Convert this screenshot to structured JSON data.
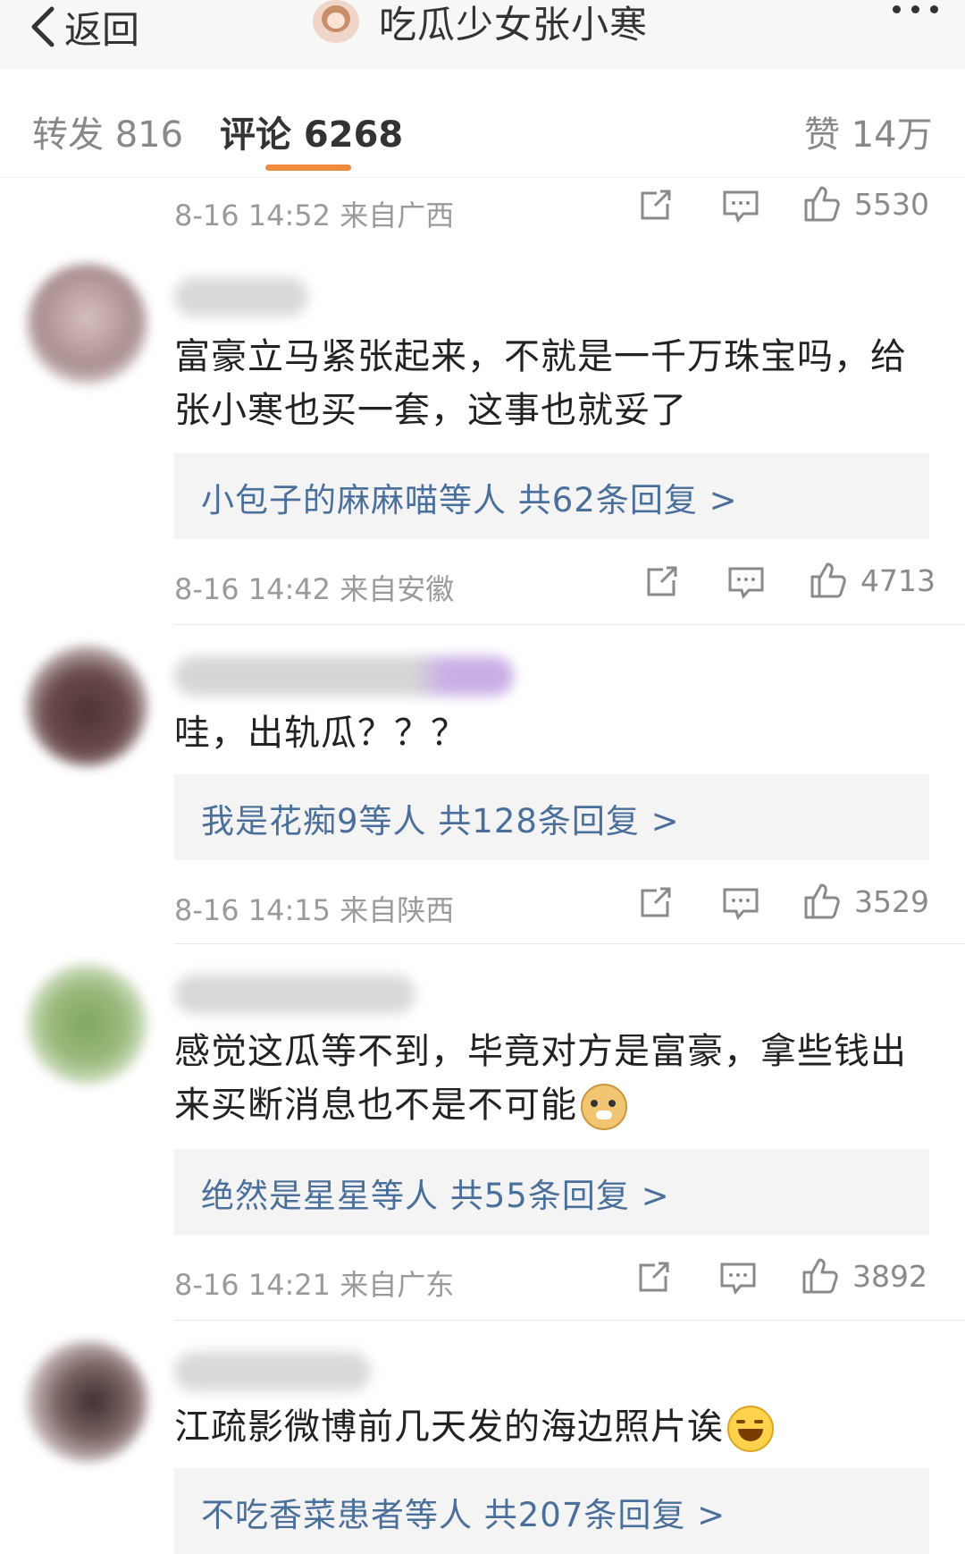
{
  "nav": {
    "back_label": "返回",
    "title": "吃瓜少女张小寒"
  },
  "tabs": [
    {
      "label": "转发 816"
    },
    {
      "label": "评论 6268"
    },
    {
      "label": "赞 14万"
    }
  ],
  "top_meta": {
    "time_location": "8-16 14:52  来自广西",
    "likes": "5530"
  },
  "comments": [
    {
      "text": "富豪立马紧张起来，不就是一千万珠宝吗，给张小寒也买一套，这事也就妥了",
      "replies": "小包子的麻麻喵等人  共62条回复 >",
      "time_location": "8-16 14:42  来自安徽",
      "likes": "4713",
      "avatar_color": "#b79a9c"
    },
    {
      "text": "哇，出轨瓜？？？",
      "replies": "我是花痴9等人  共128条回复 >",
      "time_location": "8-16 14:15  来自陕西",
      "likes": "3529",
      "avatar_color": "#5b4040"
    },
    {
      "text": "感觉这瓜等不到，毕竟对方是富豪，拿些钱出来买断消息也不是不可能",
      "emoji": "doge-icon",
      "replies": "绝然是星星等人  共55条回复 >",
      "time_location": "8-16 14:21  来自广东",
      "likes": "3892",
      "avatar_color": "#8fae73"
    },
    {
      "text": "江疏影微博前几天发的海边照片诶",
      "emoji": "laugh-cry-icon",
      "replies": "不吃香菜患者等人  共207条回复 >",
      "avatar_color": "#6b5656"
    }
  ],
  "colors": {
    "accent_orange": "#f08a3c",
    "reply_link": "#4a6f9b",
    "meta_gray": "#9a9a9a"
  }
}
